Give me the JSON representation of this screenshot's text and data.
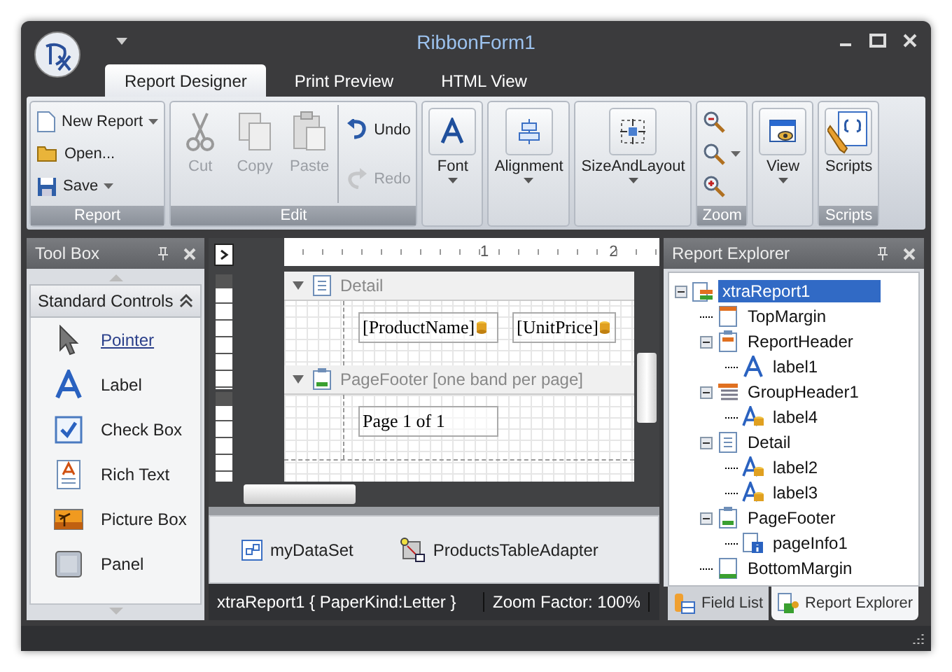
{
  "window": {
    "title": "RibbonForm1"
  },
  "tabs": [
    {
      "label": "Report Designer",
      "selected": true
    },
    {
      "label": "Print Preview",
      "selected": false
    },
    {
      "label": "HTML View",
      "selected": false
    }
  ],
  "ribbon": [
    {
      "caption": "Report",
      "items": [
        {
          "kind": "small",
          "label": "New Report",
          "dropdown": true,
          "disabled": false
        },
        {
          "kind": "small",
          "label": "Open...",
          "dropdown": false,
          "disabled": false
        },
        {
          "kind": "small",
          "label": "Save",
          "dropdown": true,
          "disabled": false
        }
      ]
    },
    {
      "caption": "Edit",
      "items": [
        {
          "kind": "large",
          "label": "Cut",
          "dropdown": false,
          "disabled": true
        },
        {
          "kind": "large",
          "label": "Copy",
          "dropdown": false,
          "disabled": true
        },
        {
          "kind": "large",
          "label": "Paste",
          "dropdown": false,
          "disabled": true
        },
        {
          "kind": "small",
          "label": "Undo",
          "dropdown": false,
          "disabled": false
        },
        {
          "kind": "small",
          "label": "Redo",
          "dropdown": false,
          "disabled": true
        }
      ]
    },
    {
      "items": [
        {
          "kind": "large",
          "label": "Font",
          "dropdown": true,
          "disabled": false
        }
      ]
    },
    {
      "items": [
        {
          "kind": "large",
          "label": "Alignment",
          "dropdown": true,
          "disabled": false
        }
      ]
    },
    {
      "items": [
        {
          "kind": "large",
          "label": "SizeAndLayout",
          "dropdown": true,
          "disabled": false
        }
      ]
    },
    {
      "caption": "Zoom",
      "items": [
        {
          "kind": "icon",
          "dropdown": false,
          "disabled": false
        },
        {
          "kind": "icon",
          "dropdown": true,
          "disabled": false
        },
        {
          "kind": "icon",
          "dropdown": false,
          "disabled": false
        }
      ]
    },
    {
      "items": [
        {
          "kind": "large",
          "label": "View",
          "dropdown": true,
          "disabled": false
        }
      ]
    },
    {
      "caption": "Scripts",
      "items": [
        {
          "kind": "large",
          "label": "Scripts",
          "dropdown": false,
          "disabled": false
        }
      ]
    }
  ],
  "toolbox": {
    "title": "Tool Box",
    "section": "Standard Controls",
    "items": [
      {
        "label": "Pointer",
        "selected": true
      },
      {
        "label": "Label",
        "selected": false
      },
      {
        "label": "Check Box",
        "selected": false
      },
      {
        "label": "Rich Text",
        "selected": false
      },
      {
        "label": "Picture Box",
        "selected": false
      },
      {
        "label": "Panel",
        "selected": false
      }
    ]
  },
  "designer": {
    "ruler": [
      "1",
      "2"
    ],
    "bands": [
      {
        "kind": "detail",
        "title": "Detail",
        "controls": [
          {
            "text": "[ProductName]",
            "bound": true
          },
          {
            "text": "[UnitPrice]",
            "bound": true
          }
        ]
      },
      {
        "kind": "footer",
        "title": "PageFooter [one band per page]",
        "controls": [
          {
            "text": "Page 1 of 1",
            "bound": false
          }
        ]
      }
    ],
    "tray": [
      {
        "kind": "dataset",
        "label": "myDataSet"
      },
      {
        "kind": "adapter",
        "label": "ProductsTableAdapter"
      }
    ],
    "status": [
      "xtraReport1 { PaperKind:Letter }",
      "Zoom Factor: 100%"
    ]
  },
  "explorer": {
    "title": "Report Explorer",
    "tree": [
      {
        "label": "xtraReport1",
        "kind": "report",
        "selected": true,
        "expanded": true,
        "children": [
          {
            "label": "TopMargin",
            "kind": "margin",
            "selected": false
          },
          {
            "label": "ReportHeader",
            "kind": "band",
            "selected": false,
            "expanded": true,
            "children": [
              {
                "label": "label1",
                "kind": "label",
                "selected": false
              }
            ]
          },
          {
            "label": "GroupHeader1",
            "kind": "group",
            "selected": false,
            "expanded": true,
            "children": [
              {
                "label": "label4",
                "kind": "datalabel",
                "selected": false
              }
            ]
          },
          {
            "label": "Detail",
            "kind": "detail",
            "selected": false,
            "expanded": true,
            "children": [
              {
                "label": "label2",
                "kind": "datalabel",
                "selected": false
              },
              {
                "label": "label3",
                "kind": "datalabel",
                "selected": false
              }
            ]
          },
          {
            "label": "PageFooter",
            "kind": "band",
            "selected": false,
            "expanded": true,
            "children": [
              {
                "label": "pageInfo1",
                "kind": "pageinfo",
                "selected": false
              }
            ]
          },
          {
            "label": "BottomMargin",
            "kind": "margin",
            "selected": false
          }
        ]
      }
    ],
    "tabs": [
      {
        "label": "Field List",
        "selected": false
      },
      {
        "label": "Report Explorer",
        "selected": true
      }
    ]
  }
}
